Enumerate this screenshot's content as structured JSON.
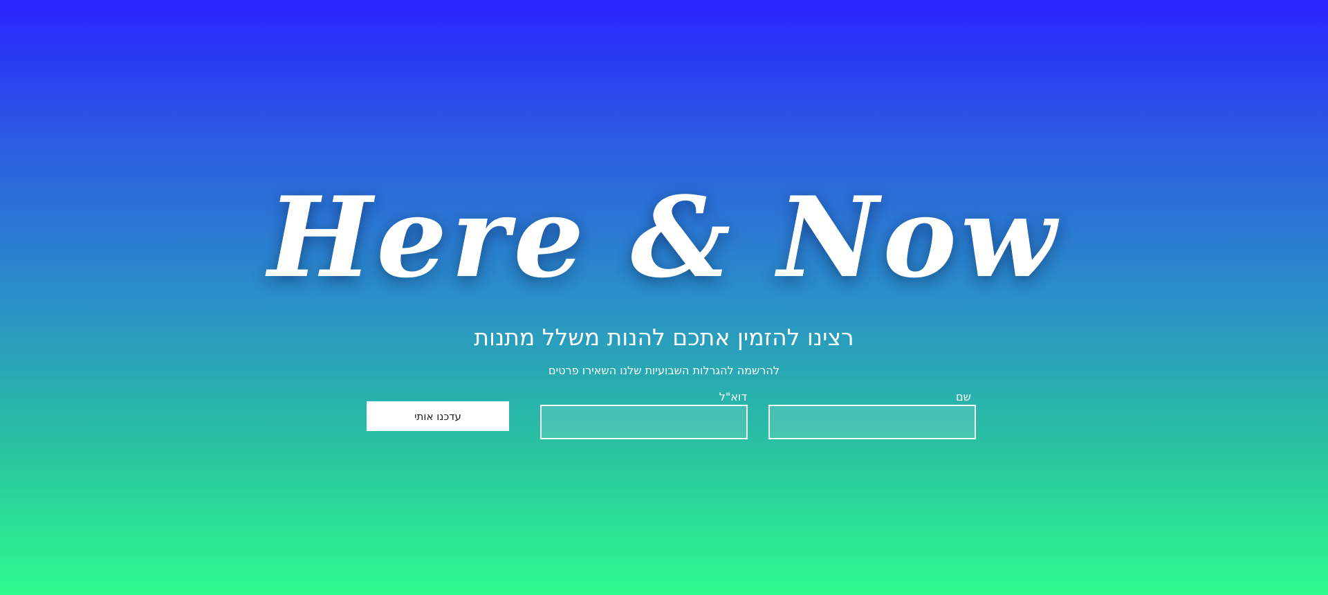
{
  "hero": {
    "logo_text": "Here & Now",
    "headline": "רצינו להזמין אתכם להנות משלל מתנות",
    "subline": "להרשמה להגרלות השבועיות שלנו השאירו פרטים"
  },
  "form": {
    "name_label": "שם",
    "email_label": "דוא\"ל",
    "submit_label": "עדכנו אותי"
  },
  "colors": {
    "gradient_top": "#2a24ff",
    "gradient_bottom": "#2dfc8e",
    "button_background": "#ffffff"
  }
}
